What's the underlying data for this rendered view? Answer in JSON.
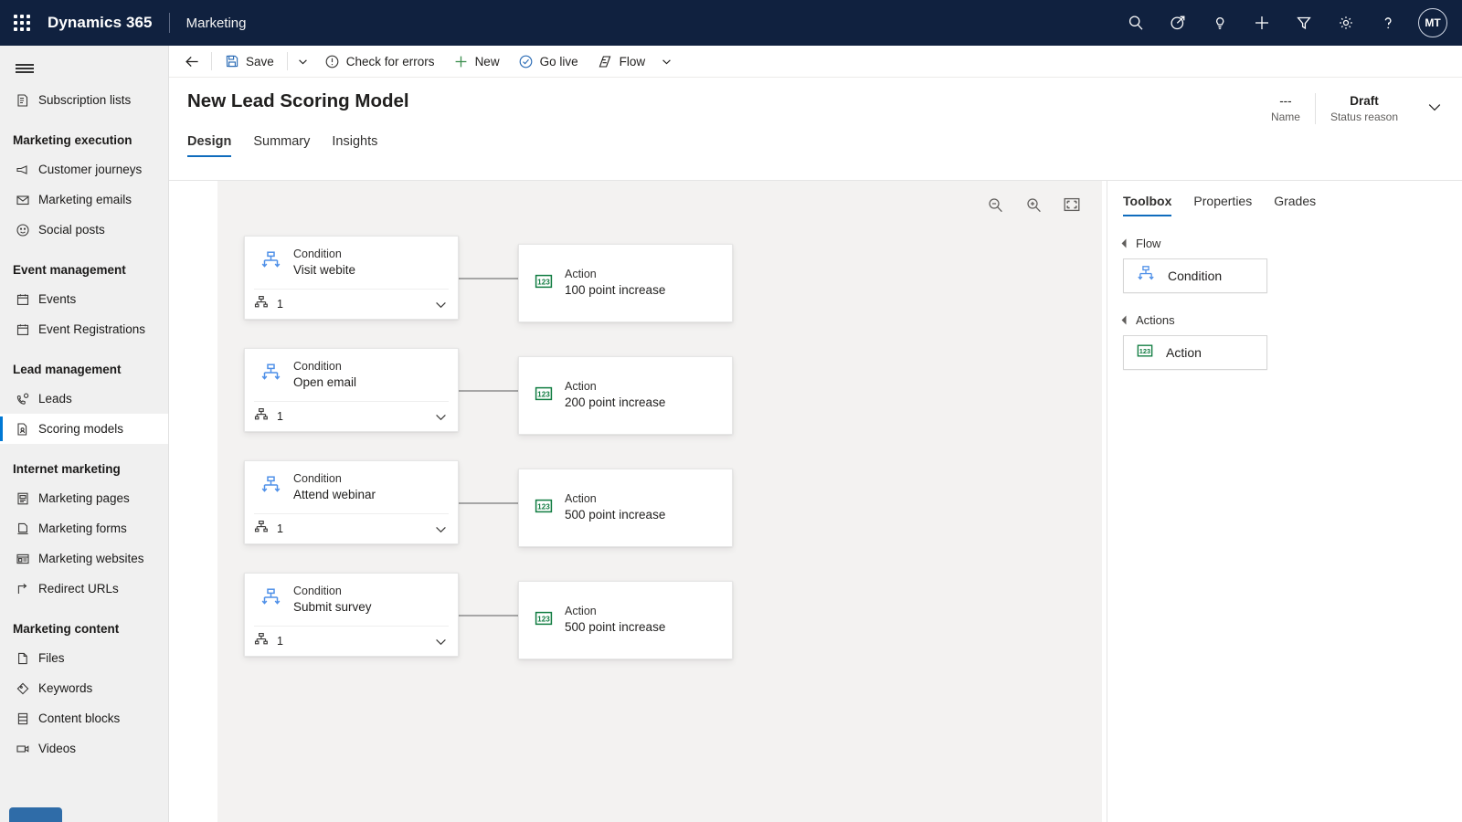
{
  "topnav": {
    "waffle_label": "app-launcher",
    "brand": "Dynamics 365",
    "app_name": "Marketing",
    "icons": [
      {
        "name": "search-icon",
        "label": "Search"
      },
      {
        "name": "focused-target-icon",
        "label": "Relevance search"
      },
      {
        "name": "lightbulb-icon",
        "label": "Insights"
      },
      {
        "name": "plus-icon",
        "label": "Quick create"
      },
      {
        "name": "filter-icon",
        "label": "Filter"
      },
      {
        "name": "gear-icon",
        "label": "Settings"
      },
      {
        "name": "help-icon",
        "label": "Help"
      }
    ],
    "avatar_initials": "MT"
  },
  "sidebar": {
    "items": [
      {
        "type": "item",
        "label": "Subscription lists",
        "icon": "subscription-list-icon",
        "selected": false
      },
      {
        "type": "group",
        "label": "Marketing execution"
      },
      {
        "type": "item",
        "label": "Customer journeys",
        "icon": "megaphone-icon",
        "selected": false
      },
      {
        "type": "item",
        "label": "Marketing emails",
        "icon": "mail-icon",
        "selected": false
      },
      {
        "type": "item",
        "label": "Social posts",
        "icon": "smiley-icon",
        "selected": false
      },
      {
        "type": "group",
        "label": "Event management"
      },
      {
        "type": "item",
        "label": "Events",
        "icon": "calendar-icon",
        "selected": false
      },
      {
        "type": "item",
        "label": "Event Registrations",
        "icon": "calendar-icon",
        "selected": false
      },
      {
        "type": "group",
        "label": "Lead management"
      },
      {
        "type": "item",
        "label": "Leads",
        "icon": "lead-icon",
        "selected": false
      },
      {
        "type": "item",
        "label": "Scoring models",
        "icon": "scoring-model-icon",
        "selected": true
      },
      {
        "type": "group",
        "label": "Internet marketing"
      },
      {
        "type": "item",
        "label": "Marketing pages",
        "icon": "page-icon",
        "selected": false
      },
      {
        "type": "item",
        "label": "Marketing forms",
        "icon": "form-icon",
        "selected": false
      },
      {
        "type": "item",
        "label": "Marketing websites",
        "icon": "website-icon",
        "selected": false
      },
      {
        "type": "item",
        "label": "Redirect URLs",
        "icon": "redirect-arrow-icon",
        "selected": false
      },
      {
        "type": "group",
        "label": "Marketing content"
      },
      {
        "type": "item",
        "label": "Files",
        "icon": "file-icon",
        "selected": false
      },
      {
        "type": "item",
        "label": "Keywords",
        "icon": "tag-icon",
        "selected": false
      },
      {
        "type": "item",
        "label": "Content blocks",
        "icon": "block-icon",
        "selected": false
      },
      {
        "type": "item",
        "label": "Videos",
        "icon": "video-icon",
        "selected": false
      }
    ]
  },
  "commandbar": {
    "back_label": "Back",
    "buttons": [
      {
        "name": "save-button",
        "label": "Save",
        "icon": "save-icon"
      },
      {
        "name": "save-options-chevron",
        "label": "",
        "icon": "chevron-down-icon"
      },
      {
        "name": "check-for-errors-button",
        "label": "Check for errors",
        "icon": "error-circle-icon"
      },
      {
        "name": "new-button",
        "label": "New",
        "icon": "plus-icon"
      },
      {
        "name": "go-live-button",
        "label": "Go live",
        "icon": "check-circle-icon"
      },
      {
        "name": "flow-button",
        "label": "Flow",
        "icon": "flow-icon"
      },
      {
        "name": "flow-options-chevron",
        "label": "",
        "icon": "chevron-down-icon"
      }
    ]
  },
  "pageheader": {
    "title": "New Lead Scoring Model",
    "tabs": [
      {
        "label": "Design",
        "active": true
      },
      {
        "label": "Summary",
        "active": false
      },
      {
        "label": "Insights",
        "active": false
      }
    ],
    "status": {
      "name_value": "---",
      "name_label": "Name",
      "status_value": "Draft",
      "status_label": "Status reason"
    }
  },
  "canvas": {
    "tools": [
      {
        "name": "zoom-out-icon",
        "label": "Zoom out"
      },
      {
        "name": "zoom-in-icon",
        "label": "Zoom in"
      },
      {
        "name": "fit-to-screen-icon",
        "label": "Fit to screen"
      }
    ],
    "rows": [
      {
        "condition": {
          "kind": "Condition",
          "name": "Visit webite",
          "count": "1"
        },
        "action": {
          "kind": "Action",
          "name": "100 point increase"
        }
      },
      {
        "condition": {
          "kind": "Condition",
          "name": "Open email",
          "count": "1"
        },
        "action": {
          "kind": "Action",
          "name": "200 point increase"
        }
      },
      {
        "condition": {
          "kind": "Condition",
          "name": "Attend webinar",
          "count": "1"
        },
        "action": {
          "kind": "Action",
          "name": "500 point increase"
        }
      },
      {
        "condition": {
          "kind": "Condition",
          "name": "Submit survey",
          "count": "1"
        },
        "action": {
          "kind": "Action",
          "name": "500 point increase"
        }
      }
    ]
  },
  "rightpanel": {
    "tabs": [
      {
        "label": "Toolbox",
        "active": true
      },
      {
        "label": "Properties",
        "active": false
      },
      {
        "label": "Grades",
        "active": false
      }
    ],
    "sections": [
      {
        "label": "Flow",
        "items": [
          {
            "label": "Condition",
            "icon": "condition-icon"
          }
        ]
      },
      {
        "label": "Actions",
        "items": [
          {
            "label": "Action",
            "icon": "action-123-icon"
          }
        ]
      }
    ]
  },
  "colors": {
    "topnav_bg": "#10213f",
    "accent": "#0f6cbd",
    "selected_bar": "#0078d4",
    "canvas_bg": "#f3f2f1",
    "condition_blue": "#4f90e8",
    "action_green": "#107c41"
  }
}
